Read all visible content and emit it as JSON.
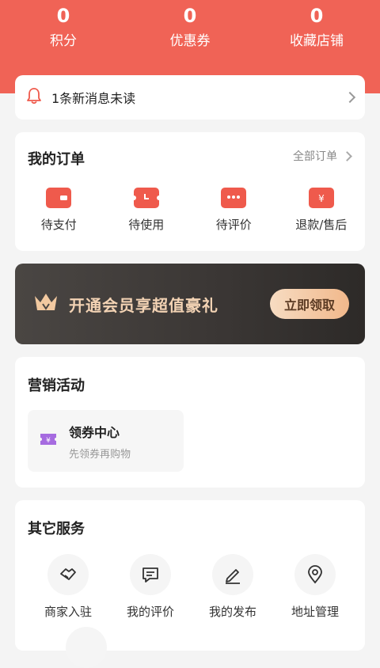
{
  "stats": [
    {
      "value": "0",
      "label": "积分"
    },
    {
      "value": "0",
      "label": "优惠券"
    },
    {
      "value": "0",
      "label": "收藏店铺"
    }
  ],
  "notice": {
    "icon": "bell-icon",
    "text": "1条新消息未读"
  },
  "orders": {
    "title": "我的订单",
    "all_label": "全部订单",
    "items": [
      {
        "label": "待支付",
        "icon": "wallet-icon"
      },
      {
        "label": "待使用",
        "icon": "ticket-clock-icon"
      },
      {
        "label": "待评价",
        "icon": "chat-dots-icon"
      },
      {
        "label": "退款/售后",
        "icon": "yen-refund-icon"
      }
    ]
  },
  "vip": {
    "text": "开通会员享超值豪礼",
    "button": "立即领取",
    "icon": "crown-icon"
  },
  "marketing": {
    "title": "营销活动",
    "coupon": {
      "title": "领券中心",
      "subtitle": "先领券再购物",
      "icon": "coupon-icon"
    }
  },
  "services": {
    "title": "其它服务",
    "items": [
      {
        "label": "商家入驻",
        "icon": "handshake-icon"
      },
      {
        "label": "我的评价",
        "icon": "comment-icon"
      },
      {
        "label": "我的发布",
        "icon": "pen-icon"
      },
      {
        "label": "地址管理",
        "icon": "location-icon"
      }
    ]
  },
  "colors": {
    "brand": "#f06356",
    "accent_red": "#ef5a4c",
    "vip_gold": "#f3d3b4",
    "coupon_purple": "#a66be0"
  }
}
